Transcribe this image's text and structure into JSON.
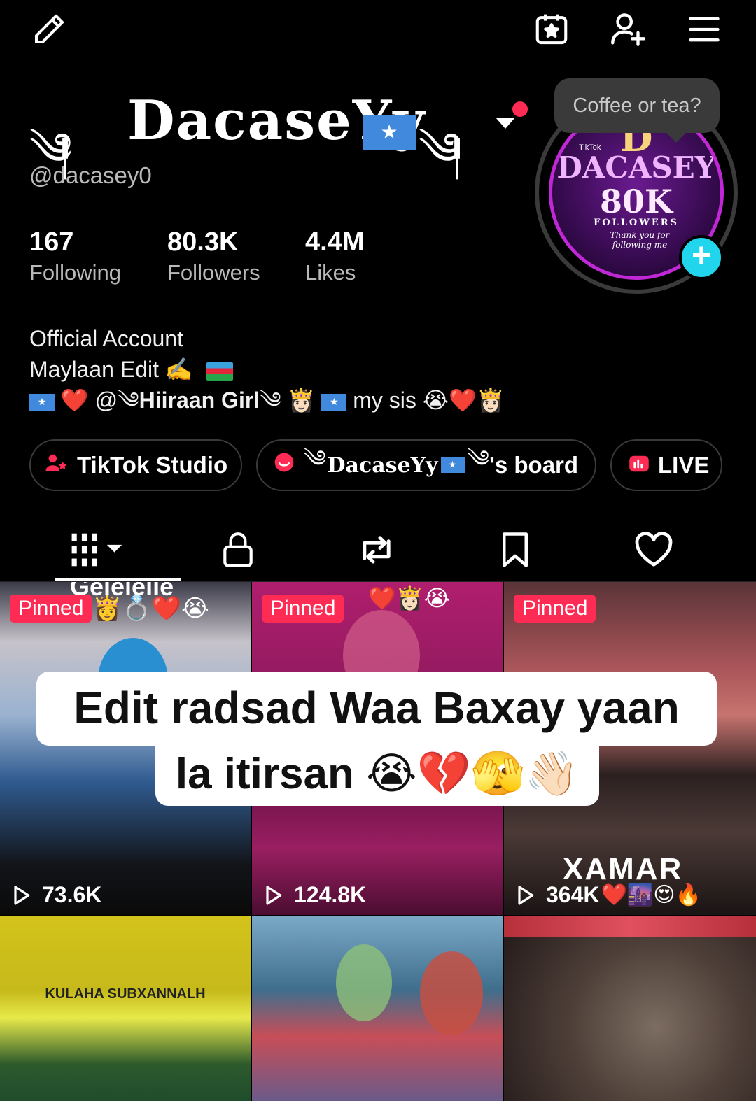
{
  "header": {
    "icons": [
      "pencil-icon",
      "calendar-star-icon",
      "add-user-icon",
      "menu-icon"
    ]
  },
  "profile": {
    "display_name": "DacaseYy",
    "username": "@dacasey0",
    "tooltip": "Coffee or tea?",
    "avatar": {
      "line1": "D",
      "line2": "DACASEY",
      "line3": "80K",
      "line4": "FOLLOWERS",
      "line5": "Thank you for following me",
      "brand": "TikTok"
    },
    "stats": [
      {
        "value": "167",
        "label": "Following"
      },
      {
        "value": "80.3K",
        "label": "Followers"
      },
      {
        "value": "4.4M",
        "label": "Likes"
      }
    ],
    "bio": {
      "line1": "Official Account",
      "line2": "Maylaan Edit ✍️",
      "line3_mention": "@",
      "line3_name": "Hiiraan Girl",
      "line3_sis": "my sis 😭❤️👸🏻"
    }
  },
  "pills": {
    "studio": "TikTok Studio",
    "board_name": "DacaseYy",
    "board_suffix": "'s board",
    "live": "LIVE"
  },
  "tabs": [
    "videos-tab",
    "private-tab",
    "reposts-tab",
    "favorites-tab",
    "liked-tab"
  ],
  "grid": {
    "overlay_caption_line1": "Edit radsad Waa Baxay yaan",
    "overlay_caption_line2": "la itirsan 😭💔🫣👋🏻",
    "videos": [
      {
        "pinned": "Pinned",
        "views": "73.6K",
        "top_text": "Gelelelle"
      },
      {
        "pinned": "Pinned",
        "views": "124.8K",
        "top_text": ""
      },
      {
        "pinned": "Pinned",
        "views": "364K",
        "top_text": "",
        "caption": "XAMAR"
      },
      {
        "pinned": "",
        "views": "",
        "top_text": "KULAHA SUBXANNALH"
      },
      {
        "pinned": "",
        "views": "",
        "top_text": ""
      },
      {
        "pinned": "",
        "views": "",
        "top_text": ""
      }
    ]
  },
  "colors": {
    "accent": "#fe2c55",
    "cyan": "#20d5ec",
    "muted": "#b9b9b9",
    "flag_blue": "#4189dd"
  }
}
